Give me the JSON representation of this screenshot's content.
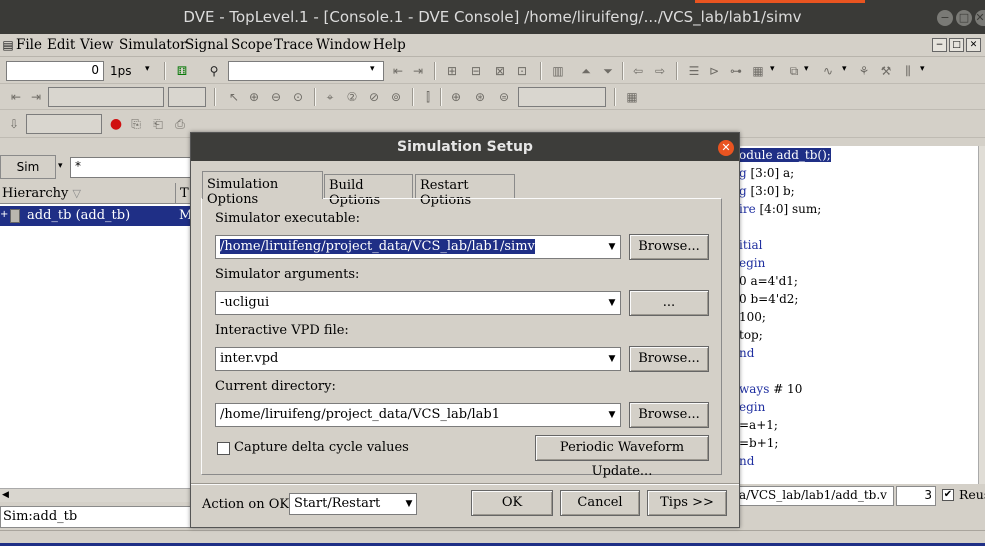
{
  "window": {
    "title": "DVE - TopLevel.1 - [Console.1 - DVE Console]  /home/liruifeng/.../VCS_lab/lab1/simv",
    "min_glyph": "−",
    "max_glyph": "□",
    "close_glyph": "✕"
  },
  "menu": {
    "items": [
      "File",
      "Edit",
      "View",
      "Simulator",
      "Signal",
      "Scope",
      "Trace",
      "Window",
      "Help"
    ]
  },
  "toolbar": {
    "time_value": "0",
    "time_unit": "1ps",
    "search_value": "",
    "arrow": "▾"
  },
  "left_pane": {
    "sim_label": "Sim",
    "filter_value": "*",
    "hierarchy_header": "Hierarchy",
    "type_header": "T",
    "expand_glyph": "+",
    "rows": [
      {
        "name": "add_tb (add_tb)",
        "type": "M"
      }
    ],
    "status_text": "Sim:add_tb"
  },
  "source_pane": {
    "lines": [
      {
        "keyword": "odule",
        "rest": " add_tb();",
        "selected": true
      },
      {
        "keyword": "g",
        "rest": " [3:0] a;",
        "selected": false
      },
      {
        "keyword": "g",
        "rest": " [3:0] b;",
        "selected": false
      },
      {
        "keyword": "ire",
        "rest": " [4:0] sum;",
        "selected": false
      },
      {
        "keyword": "",
        "rest": "",
        "selected": false
      },
      {
        "keyword": "itial",
        "rest": "",
        "selected": false
      },
      {
        "keyword": "egin",
        "rest": "",
        "selected": false
      },
      {
        "keyword": "",
        "rest": "0 a=4'd1;",
        "selected": false
      },
      {
        "keyword": "",
        "rest": "0 b=4'd2;",
        "selected": false
      },
      {
        "keyword": "",
        "rest": "100;",
        "selected": false
      },
      {
        "keyword": "",
        "rest": "top;",
        "selected": false
      },
      {
        "keyword": "nd",
        "rest": "",
        "selected": false
      },
      {
        "keyword": "",
        "rest": "",
        "selected": false
      },
      {
        "keyword": "ways",
        "rest": " # 10",
        "selected": false
      },
      {
        "keyword": "egin",
        "rest": "",
        "selected": false
      },
      {
        "keyword": "",
        "rest": "=a+1;",
        "selected": false
      },
      {
        "keyword": "",
        "rest": "=b+1;",
        "selected": false
      },
      {
        "keyword": "nd",
        "rest": "",
        "selected": false
      }
    ],
    "path_text": "a/VCS_lab/lab1/add_tb.v",
    "line_number": "3",
    "reuse_label": "Reus",
    "reuse_checked": "✔"
  },
  "dialog": {
    "title": "Simulation Setup",
    "close_glyph": "✕",
    "tabs": [
      "Simulation Options",
      "Build Options",
      "Restart Options"
    ],
    "active_tab": 0,
    "fields": {
      "executable": {
        "label": "Simulator executable:",
        "value": "/home/liruifeng/project_data/VCS_lab/lab1/simv",
        "button": "Browse..."
      },
      "arguments": {
        "label": "Simulator arguments:",
        "value": "-ucligui",
        "button": "..."
      },
      "vpd": {
        "label": "Interactive VPD file:",
        "value": "inter.vpd",
        "button": "Browse..."
      },
      "directory": {
        "label": "Current directory:",
        "value": "/home/liruifeng/project_data/VCS_lab/lab1",
        "button": "Browse..."
      }
    },
    "capture_delta": {
      "label": "Capture delta cycle values",
      "checked": false
    },
    "periodic_button": "Periodic Waveform Update...",
    "action_label": "Action on OK:",
    "action_value": "Start/Restart",
    "ok_button": "OK",
    "cancel_button": "Cancel",
    "tips_button": "Tips >>"
  },
  "colors": {
    "selection": "#1f2f86",
    "title_bar": "#3a3a37",
    "accent": "#e95420"
  }
}
